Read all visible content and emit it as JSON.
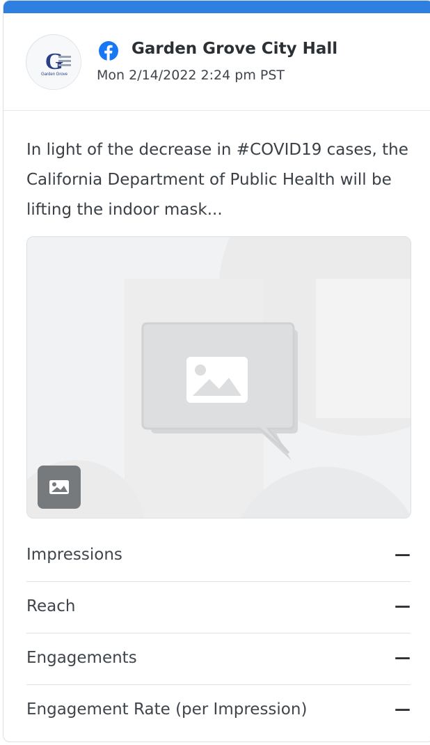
{
  "post": {
    "network": "facebook",
    "network_icon": "facebook-icon",
    "page_name": "Garden Grove City Hall",
    "timestamp": "Mon 2/14/2022 2:24 pm PST",
    "text": "In light of the decrease in #COVID19 cases, the California Department of Public Health will be lifting the indoor mask...",
    "avatar": {
      "logo_letter": "G",
      "logo_caption": "Garden Grove"
    },
    "media": {
      "type": "image-placeholder",
      "badge_icon": "image-icon"
    }
  },
  "metrics": [
    {
      "label": "Impressions",
      "value": "—"
    },
    {
      "label": "Reach",
      "value": "—"
    },
    {
      "label": "Engagements",
      "value": "—"
    },
    {
      "label": "Engagement Rate (per Impression)",
      "value": "—"
    }
  ],
  "colors": {
    "accent_bar": "#2f7fe1",
    "facebook_blue": "#1877f2",
    "text_primary": "#2b3035",
    "divider": "#dfe2e5"
  }
}
